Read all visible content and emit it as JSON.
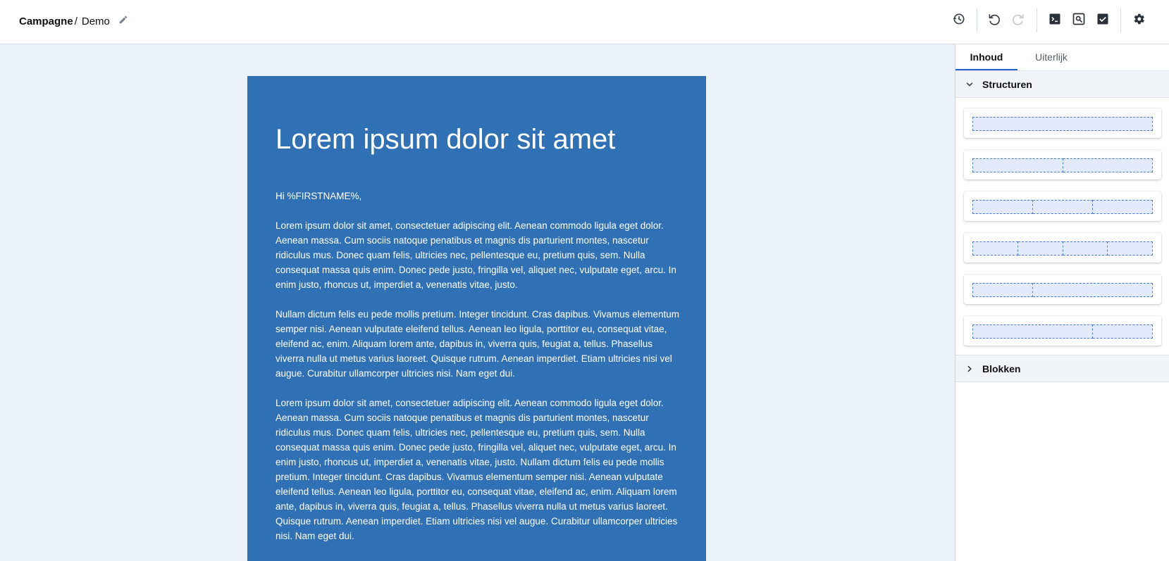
{
  "header": {
    "breadcrumb": {
      "campaign": "Campagne",
      "separator": "/",
      "name": "Demo"
    },
    "icons": {
      "edit": "pencil-icon",
      "history": "history-icon",
      "undo": "undo-icon",
      "redo": "redo-icon",
      "code": "code-terminal-icon",
      "preview": "preview-icon",
      "test": "checkbox-icon",
      "settings": "gear-icon"
    }
  },
  "email": {
    "title": "Lorem ipsum dolor sit amet",
    "greeting": "Hi %FIRSTNAME%,",
    "paragraphs": [
      "Lorem ipsum dolor sit amet, consectetuer adipiscing elit. Aenean commodo ligula eget dolor. Aenean massa. Cum sociis natoque penatibus et magnis dis parturient montes, nascetur ridiculus mus. Donec quam felis, ultricies nec, pellentesque eu, pretium quis, sem. Nulla consequat massa quis enim. Donec pede justo, fringilla vel, aliquet nec, vulputate eget, arcu. In enim justo, rhoncus ut, imperdiet a, venenatis vitae, justo.",
      "Nullam dictum felis eu pede mollis pretium. Integer tincidunt. Cras dapibus. Vivamus elementum semper nisi. Aenean vulputate eleifend tellus. Aenean leo ligula, porttitor eu, consequat vitae, eleifend ac, enim. Aliquam lorem ante, dapibus in, viverra quis, feugiat a, tellus. Phasellus viverra nulla ut metus varius laoreet. Quisque rutrum. Aenean imperdiet. Etiam ultricies nisi vel augue. Curabitur ullamcorper ultricies nisi. Nam eget dui.",
      "Lorem ipsum dolor sit amet, consectetuer adipiscing elit. Aenean commodo ligula eget dolor. Aenean massa. Cum sociis natoque penatibus et magnis dis parturient montes, nascetur ridiculus mus. Donec quam felis, ultricies nec, pellentesque eu, pretium quis, sem. Nulla consequat massa quis enim. Donec pede justo, fringilla vel, aliquet nec, vulputate eget, arcu. In enim justo, rhoncus ut, imperdiet a, venenatis vitae, justo. Nullam dictum felis eu pede mollis pretium. Integer tincidunt. Cras dapibus. Vivamus elementum semper nisi. Aenean vulputate eleifend tellus. Aenean leo ligula, porttitor eu, consequat vitae, eleifend ac, enim. Aliquam lorem ante, dapibus in, viverra quis, feugiat a, tellus. Phasellus viverra nulla ut metus varius laoreet. Quisque rutrum. Aenean imperdiet. Etiam ultricies nisi vel augue. Curabitur ullamcorper ultricies nisi. Nam eget dui."
    ]
  },
  "panel": {
    "tabs": [
      {
        "label": "Inhoud",
        "active": true
      },
      {
        "label": "Uiterlijk",
        "active": false
      }
    ],
    "sections": {
      "structuren": {
        "label": "Structuren",
        "expanded": true
      },
      "blokken": {
        "label": "Blokken",
        "expanded": false
      }
    },
    "structures": [
      {
        "columns": [
          1
        ]
      },
      {
        "columns": [
          1,
          1
        ]
      },
      {
        "columns": [
          1,
          1,
          1
        ]
      },
      {
        "columns": [
          1,
          1,
          1,
          1
        ]
      },
      {
        "columns": [
          1,
          2
        ]
      },
      {
        "columns": [
          2,
          1
        ]
      }
    ]
  },
  "colors": {
    "accent": "#2563c9",
    "email_background": "#3070b5",
    "canvas_background": "#ecf2fa",
    "structure_column_fill": "#e3eafc",
    "structure_column_border": "#4b7be0"
  }
}
